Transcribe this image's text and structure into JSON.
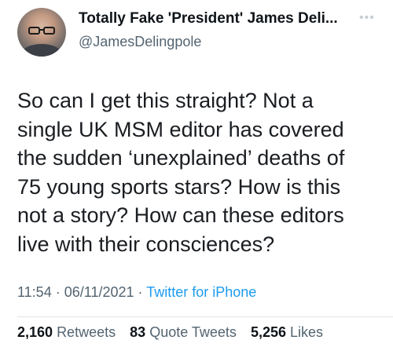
{
  "tweet": {
    "display_name": "Totally Fake 'President' James Deli...",
    "handle": "@JamesDelingpole",
    "more_icon": "ellipsis-icon",
    "text_lines": [
      "So can I get this straight? Not a",
      "single UK MSM editor has covered",
      "the sudden ‘unexplained’ deaths of",
      "75 young sports stars? How is this",
      "not a story? How can these editors",
      "live with their consciences?"
    ],
    "time": "11:54",
    "separator": "·",
    "date": "06/11/2021",
    "source": "Twitter for iPhone",
    "source_color": "#1d9bf0",
    "stats": {
      "retweets_count": "2,160",
      "retweets_label": "Retweets",
      "quotes_count": "83",
      "quotes_label": "Quote Tweets",
      "likes_count": "5,256",
      "likes_label": "Likes"
    }
  }
}
